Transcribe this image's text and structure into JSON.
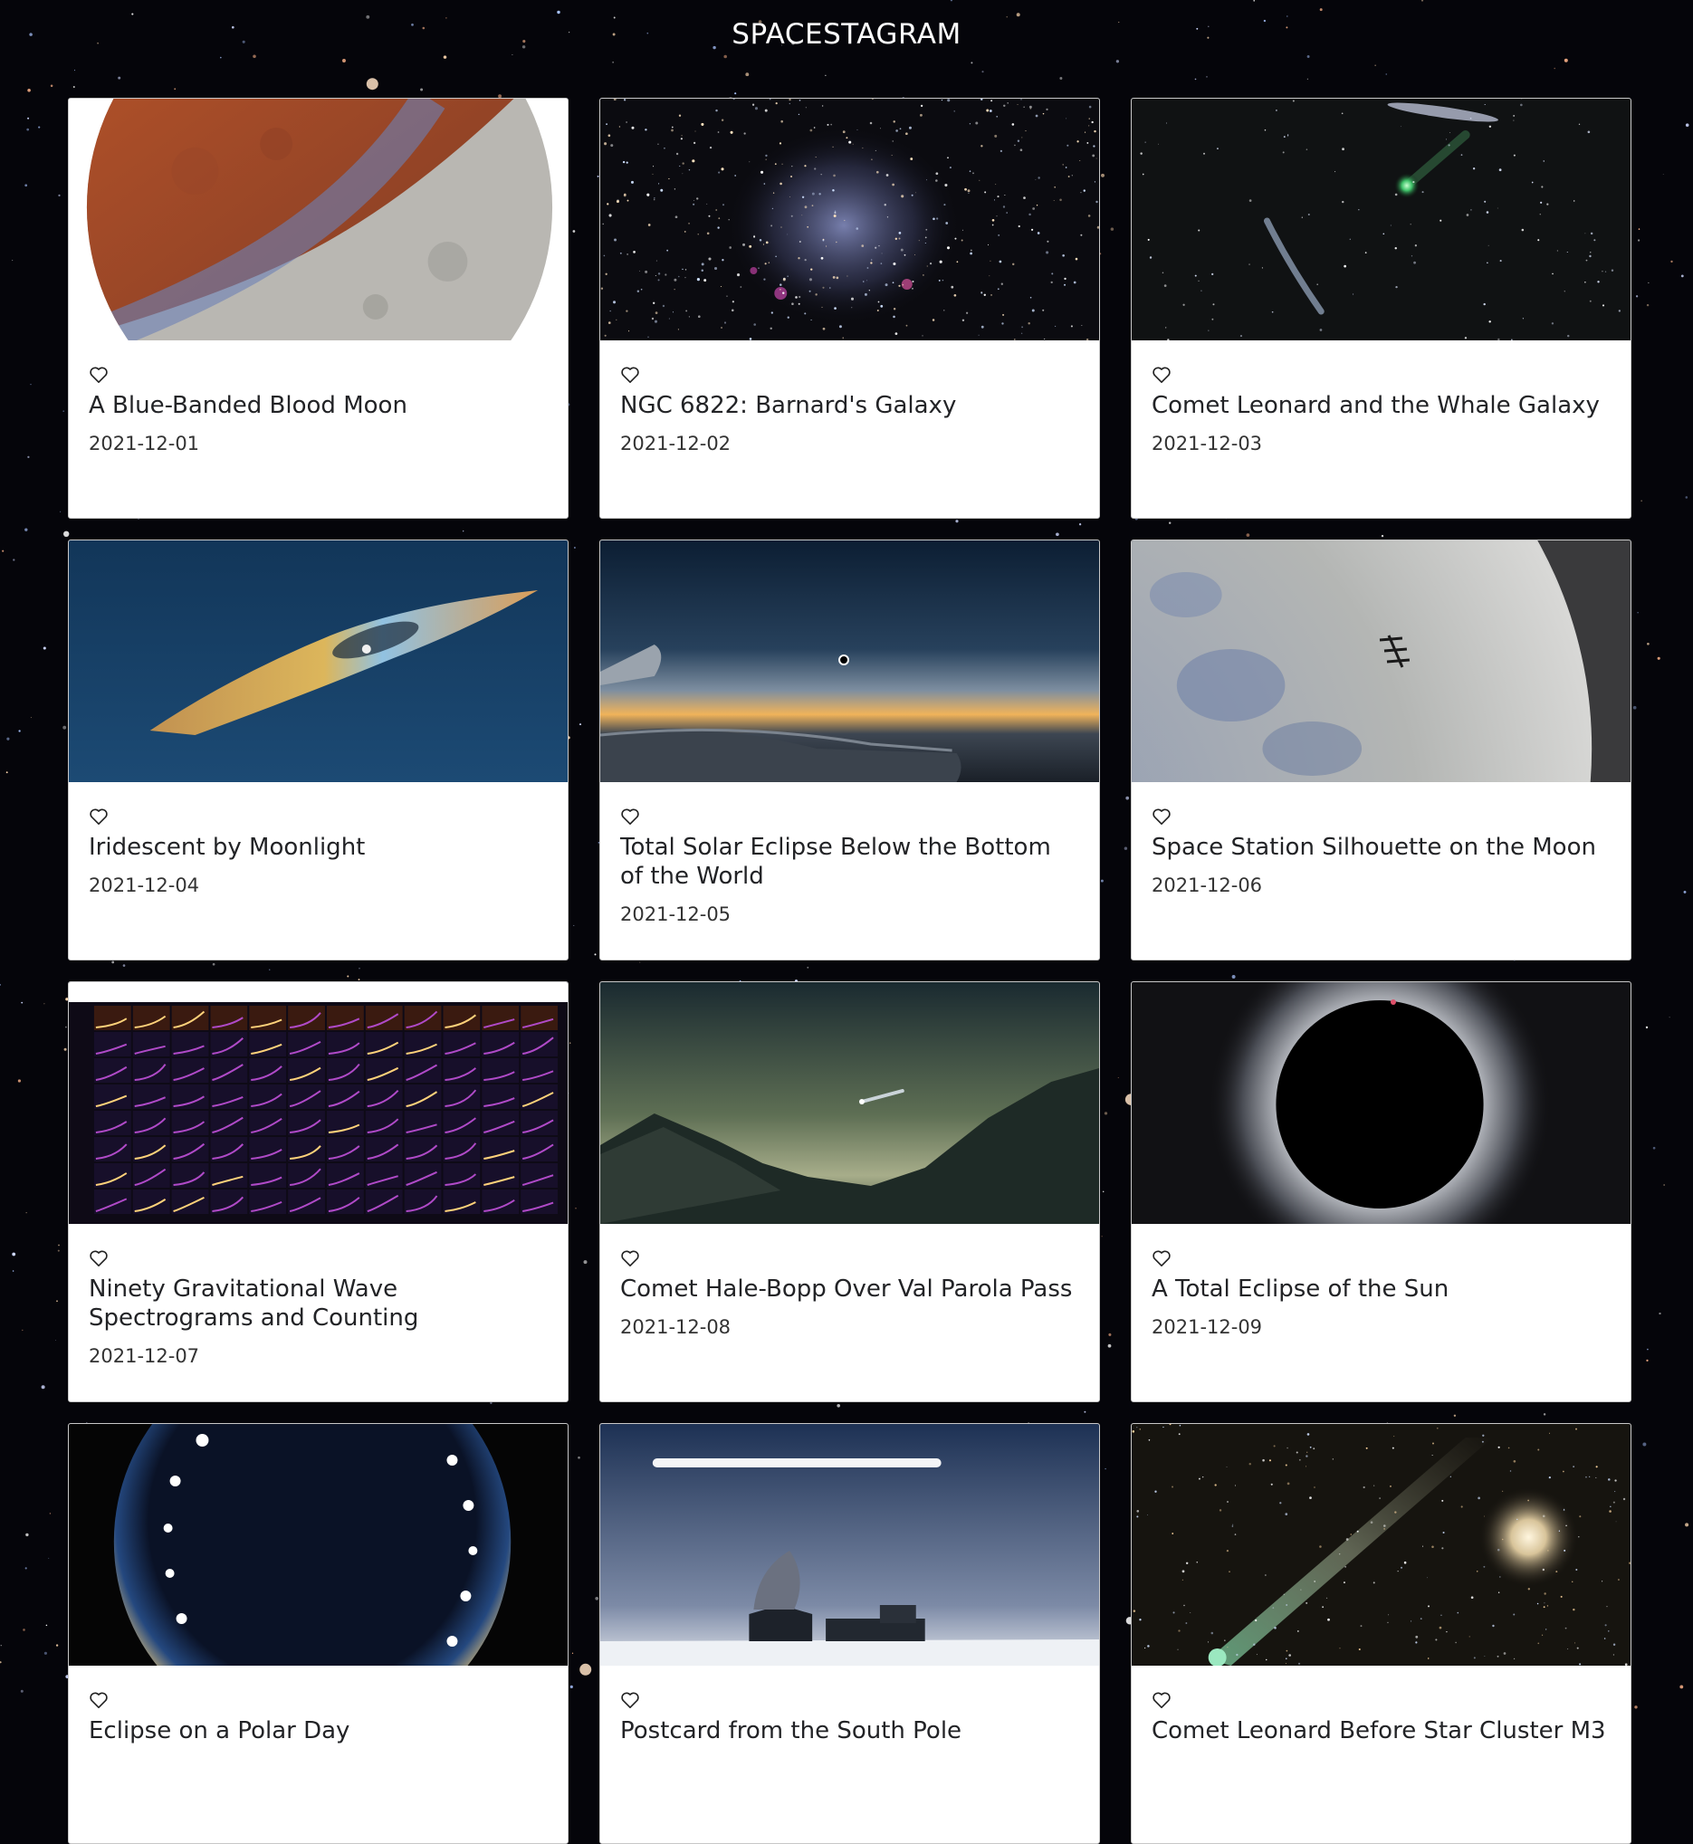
{
  "header": {
    "title": "SPACESTAGRAM"
  },
  "posts": [
    {
      "title": "A Blue-Banded Blood Moon",
      "date": "2021-12-01",
      "image": "blood-moon"
    },
    {
      "title": "NGC 6822: Barnard's Galaxy",
      "date": "2021-12-02",
      "image": "galaxy"
    },
    {
      "title": "Comet Leonard and the Whale Galaxy",
      "date": "2021-12-03",
      "image": "comet-whale"
    },
    {
      "title": "Iridescent by Moonlight",
      "date": "2021-12-04",
      "image": "iridescent-cloud"
    },
    {
      "title": "Total Solar Eclipse Below the Bottom of the World",
      "date": "2021-12-05",
      "image": "eclipse-plane"
    },
    {
      "title": "Space Station Silhouette on the Moon",
      "date": "2021-12-06",
      "image": "iss-moon"
    },
    {
      "title": "Ninety Gravitational Wave Spectrograms and Counting",
      "date": "2021-12-07",
      "image": "spectrograms"
    },
    {
      "title": "Comet Hale-Bopp Over Val Parola Pass",
      "date": "2021-12-08",
      "image": "hale-bopp"
    },
    {
      "title": "A Total Eclipse of the Sun",
      "date": "2021-12-09",
      "image": "total-eclipse"
    },
    {
      "title": "Eclipse on a Polar Day",
      "date": "",
      "image": "polar-eclipse"
    },
    {
      "title": "Postcard from the South Pole",
      "date": "",
      "image": "south-pole"
    },
    {
      "title": "Comet Leonard Before Star Cluster M3",
      "date": "",
      "image": "comet-m3"
    }
  ],
  "icons": {
    "like": "heart-outline-icon"
  },
  "colors": {
    "background": "#05050a",
    "card": "#ffffff",
    "title_text": "#ffffff"
  }
}
